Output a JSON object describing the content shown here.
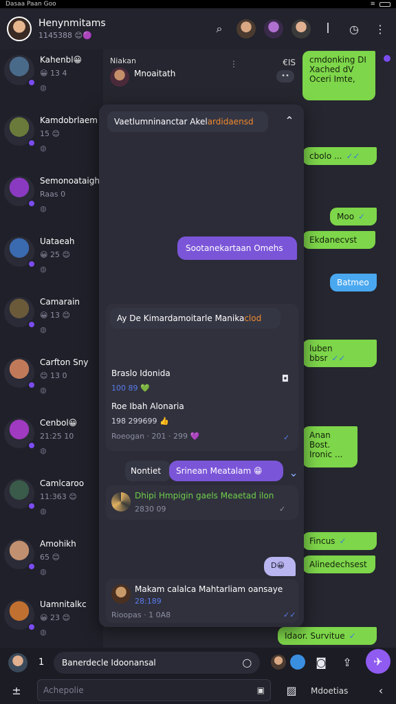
{
  "status": {
    "carrier": "Dasaa Paan Goo"
  },
  "header": {
    "title": "Henynmitams",
    "subtitle": "1145388 😊🟣"
  },
  "conversations": [
    {
      "name": "Kahenbl😀",
      "meta": "😀 13 4",
      "color": "#4a6a8a"
    },
    {
      "name": "Kamdobrlaem",
      "meta": "15 😊",
      "color": "#6a7a3a"
    },
    {
      "name": "Semonoataigho",
      "meta": "Raas 0",
      "color": "#8a3ac0"
    },
    {
      "name": "Uataeah",
      "meta": "😀 25 😊",
      "color": "#3a6ab0"
    },
    {
      "name": "Camarain",
      "meta": "😀 13 😊",
      "color": "#6a5a3a"
    },
    {
      "name": "Carfton Sny",
      "meta": "😊 13 0",
      "color": "#c07a5a"
    },
    {
      "name": "Cenbol😀",
      "meta": "21:25 10",
      "color": "#a03ac0"
    },
    {
      "name": "Camlcaroo",
      "meta": "11:363 😊",
      "color": "#3a5a4a"
    },
    {
      "name": "Amohikh",
      "meta": "65 😊",
      "color": "#c09070"
    },
    {
      "name": "Uamnitalkc",
      "meta": "😀 23 😊",
      "color": "#c07030"
    }
  ],
  "panel": {
    "label": "Niakan",
    "contact_name": "Mnoaitath",
    "counter": "€IS",
    "pill": "••",
    "search_prefix": "Vaetlumninanctar Akel",
    "search_highlight": "ardidaensd",
    "purple_message": "Sootanekartaan Omehs",
    "card2_title_prefix": "Ay De Kimardamoitarle Manika",
    "card2_title_hl": "clod",
    "item1_title": "Braslo Idonida",
    "item1_meta": "100 89 💚",
    "item2_title": "Roe Ibah Alonaria",
    "item2_meta": "198 299699 👍",
    "item2_sub": "Roeogan · 201 · 299 💜",
    "notice_label": "Nontiet",
    "notice_bubble": "Srinean Meatalam 😁",
    "link_title": "Dhipi Hmpigin gaels Meaetad ilon",
    "link_meta": "2830 09",
    "small_pill": "D😀",
    "last_title": "Makam calalca Mahtarliam oansaye",
    "last_meta": "28:189",
    "last_sub": "Rioopas · 1 0A8"
  },
  "right_bubbles": [
    "cmdonking DI Xached dV Oceri Imte,",
    "cbolo ...",
    "Moo",
    "Ekdanecvst",
    "Batmeo",
    "luben bbsr",
    "Anan Bost. Ironic ...",
    "Fincus",
    "Alinedechsest",
    "Idaor. Survitue"
  ],
  "bottom": {
    "count": "1",
    "message_field": "Banerdecle Idoonansal",
    "input_placeholder": "Achepolie",
    "label": "Mdoetias"
  }
}
